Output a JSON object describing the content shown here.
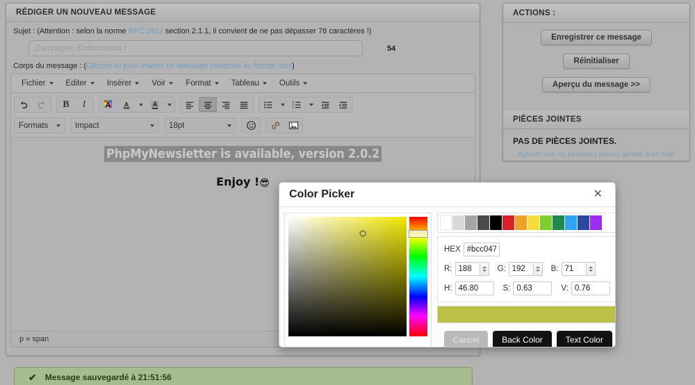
{
  "left_panel": {
    "header_title": "RÉDIGER UN NOUVEAU MESSAGE",
    "subject_hint_prefix": "Sujet : (Attention : selon la norme ",
    "subject_hint_link": "RFC 2822",
    "subject_hint_suffix": " section 2.1.1, il convient de ne pas dépasser 78 caractères !)",
    "subject_placeholder": "Campagne d'information !",
    "subject_value": "",
    "char_count": "54",
    "body_label_prefix": "Corps du message : (",
    "body_label_link": "Cliquez ici pour insérer un message composé au format html",
    "body_label_suffix": ")"
  },
  "editor": {
    "menus": [
      {
        "label": "Fichier"
      },
      {
        "label": "Editer"
      },
      {
        "label": "Insérer"
      },
      {
        "label": "Voir"
      },
      {
        "label": "Format"
      },
      {
        "label": "Tableau"
      },
      {
        "label": "Outils"
      }
    ],
    "toolbar": {
      "undo": "↶",
      "redo": "↷",
      "bold": "B",
      "italic": "I",
      "forecolor_glyph": "A",
      "textcolor_glyph": "A",
      "backcolor_glyph": "A",
      "align_left": "align-left",
      "align_center": "align-center",
      "align_right": "align-right",
      "align_justify": "align-justify",
      "bullist": "bullet-list",
      "numlist": "numbered-list",
      "outdent": "outdent",
      "indent": "indent",
      "formats_label": "Formats",
      "font_label": "Impact",
      "size_label": "18pt",
      "emoticon": "☺",
      "link": "🔗",
      "image": "🖼"
    },
    "content": {
      "selected_line": "PhpMyNewsletter is available, version 2.0.2",
      "second_line": "Enjoy !",
      "second_line_emoji": "😎"
    },
    "status_path": "p » span"
  },
  "notice": {
    "icon": "✔",
    "text": "Message sauvegardé à 21:51:56"
  },
  "actions_panel": {
    "header_title": "ACTIONS :",
    "buttons": [
      {
        "label": "Enregistrer ce message"
      },
      {
        "label": "Réinitialiser"
      },
      {
        "label": "Aperçu du message >>"
      }
    ]
  },
  "attachments_panel": {
    "header_title": "PIÈCES JOINTES",
    "empty_text": "PAS DE PIÈCES JOINTES.",
    "add_link": "Ajouter une ou plusieurs pièces jointes à ce mail"
  },
  "color_picker": {
    "title": "Color Picker",
    "close_glyph": "✕",
    "swatches": [
      "#ffffff",
      "#d9d9d9",
      "#a5a5a5",
      "#4a4a4a",
      "#000000",
      "#d91f27",
      "#f0a028",
      "#f7dc3c",
      "#7ece2e",
      "#1f8a4c",
      "#2da5f0",
      "#2a4a9e",
      "#9a2df0"
    ],
    "hex_label": "HEX",
    "hex_value": "#bcc047",
    "r_label": "R:",
    "r_value": "188",
    "g_label": "G:",
    "g_value": "192",
    "b_label": "B:",
    "b_value": "71",
    "h_label": "H:",
    "h_value": "46.80",
    "s_label": "S:",
    "s_value": "0.63",
    "v_label": "V:",
    "v_value": "0.76",
    "preview_color": "#bcc047",
    "buttons": {
      "cancel": "Cancel",
      "back_color": "Back Color",
      "text_color": "Text Color"
    }
  }
}
